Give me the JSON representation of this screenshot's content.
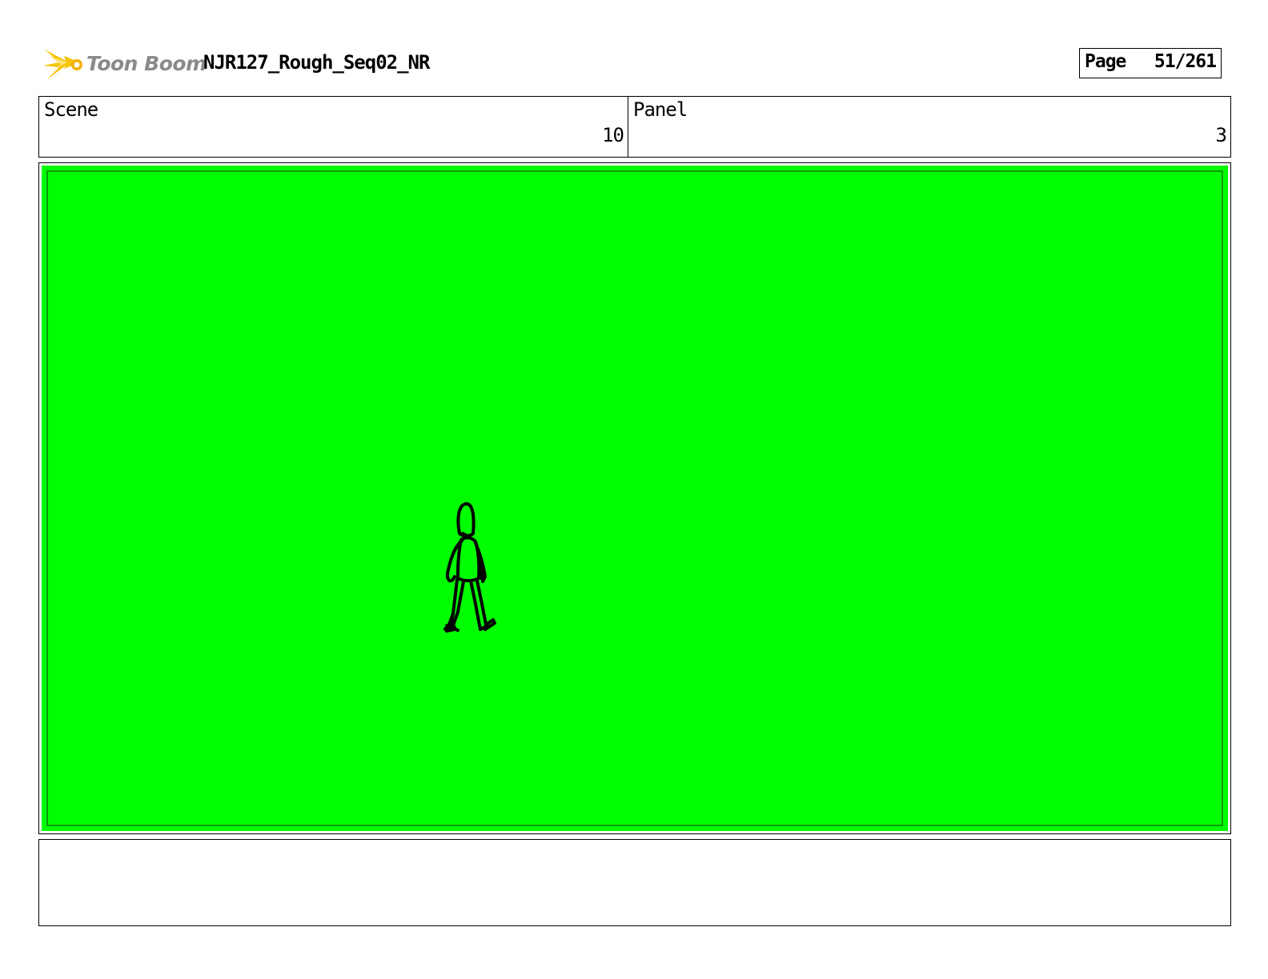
{
  "header": {
    "logo_text": "Toon Boom",
    "project_title": "NJR127_Rough_Seq02_NR",
    "page_label": "Page",
    "page_number": "51/261"
  },
  "info": {
    "scene_label": "Scene",
    "scene_value": "10",
    "panel_label": "Panel",
    "panel_value": "3"
  },
  "panel": {
    "background_color": "#00ff00",
    "figure": "stick-figure-walking"
  },
  "notes": {
    "text": ""
  },
  "colors": {
    "logo_burst": "#f5c400",
    "logo_text": "#8a8a8a",
    "screen_green": "#00ff00",
    "inner_border": "#0a9a0a"
  }
}
